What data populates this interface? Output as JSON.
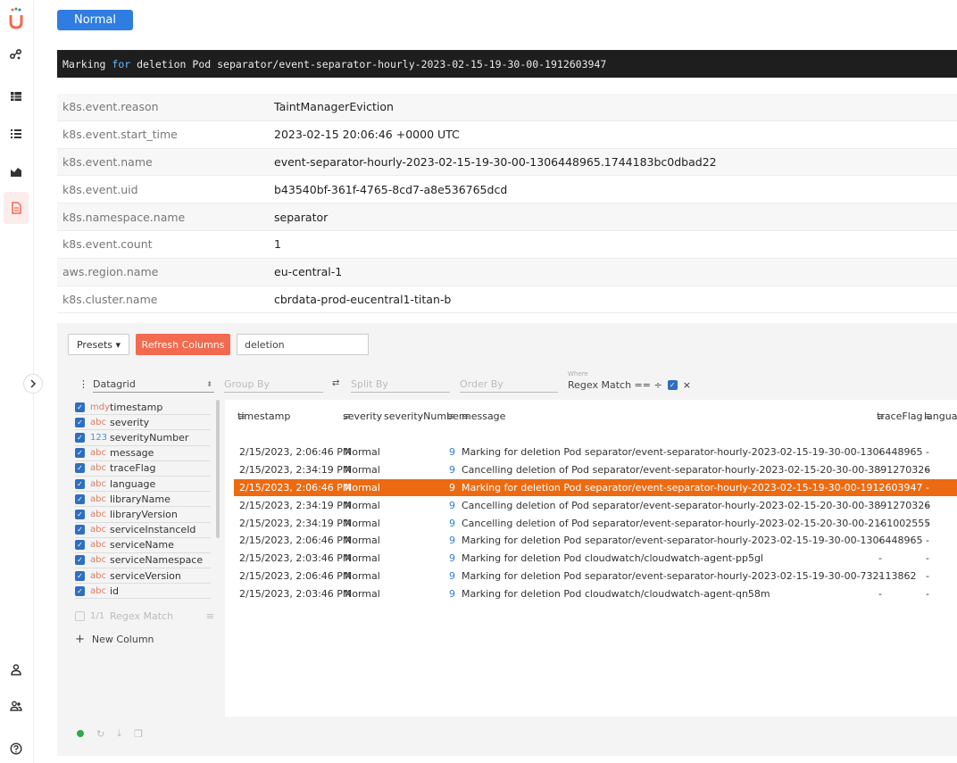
{
  "sidebar": {
    "logo_letter": "U",
    "items": [
      "share-icon",
      "table-icon",
      "list-icon",
      "dashboard-icon",
      "document-icon"
    ],
    "bottom_items": [
      "user-icon",
      "team-icon",
      "help-icon"
    ]
  },
  "log": {
    "level": "Normal",
    "message_prefix": "Marking ",
    "message_kw": "for",
    "message_rest": " deletion Pod separator/event-separator-hourly-2023-02-15-19-30-00-1912603947"
  },
  "attributes": [
    {
      "key": "k8s.event.reason",
      "value": "TaintManagerEviction"
    },
    {
      "key": "k8s.event.start_time",
      "value": "2023-02-15 20:06:46 +0000 UTC"
    },
    {
      "key": "k8s.event.name",
      "value": "event-separator-hourly-2023-02-15-19-30-00-1306448965.1744183bc0dbad22"
    },
    {
      "key": "k8s.event.uid",
      "value": "b43540bf-361f-4765-8cd7-a8e536765dcd"
    },
    {
      "key": "k8s.namespace.name",
      "value": "separator"
    },
    {
      "key": "k8s.event.count",
      "value": "1"
    },
    {
      "key": "aws.region.name",
      "value": "eu-central-1"
    },
    {
      "key": "k8s.cluster.name",
      "value": "cbrdata-prod-eucentral1-titan-b"
    }
  ],
  "toolbar": {
    "presets_label": "Presets ▾",
    "refresh_label": "Refresh Columns",
    "search_value": "deletion"
  },
  "controls": {
    "view": "Datagrid",
    "group_by_placeholder": "Group By",
    "split_by_placeholder": "Split By",
    "order_by_placeholder": "Order By",
    "where_label": "Where",
    "where_value": "Regex Match == ÷"
  },
  "columns": [
    {
      "type": "mdy",
      "name": "timestamp"
    },
    {
      "type": "abc",
      "name": "severity"
    },
    {
      "type": "123",
      "name": "severityNumber"
    },
    {
      "type": "abc",
      "name": "message"
    },
    {
      "type": "abc",
      "name": "traceFlag"
    },
    {
      "type": "abc",
      "name": "language"
    },
    {
      "type": "abc",
      "name": "libraryName"
    },
    {
      "type": "abc",
      "name": "libraryVersion"
    },
    {
      "type": "abc",
      "name": "serviceInstanceId"
    },
    {
      "type": "abc",
      "name": "serviceName"
    },
    {
      "type": "abc",
      "name": "serviceNamespace"
    },
    {
      "type": "abc",
      "name": "serviceVersion"
    },
    {
      "type": "abc",
      "name": "id"
    }
  ],
  "regex_column": {
    "type": "1/1",
    "name": "Regex Match"
  },
  "new_column_label": "New Column",
  "grid": {
    "headers": [
      "timestamp",
      "severity",
      "severityNumber",
      "message",
      "traceFlag",
      "languag"
    ],
    "rows": [
      {
        "ts": "2/15/2023, 2:06:46 PM",
        "sev": "Normal",
        "num": "9",
        "msg": "Marking for deletion Pod separator/event-separator-hourly-2023-02-15-19-30-00-1306448965",
        "tf": "-",
        "lang": "-"
      },
      {
        "ts": "2/15/2023, 2:34:19 PM",
        "sev": "Normal",
        "num": "9",
        "msg": "Cancelling deletion of Pod separator/event-separator-hourly-2023-02-15-20-30-00-3891270326",
        "tf": "-",
        "lang": "-"
      },
      {
        "ts": "2/15/2023, 2:06:46 PM",
        "sev": "Normal",
        "num": "9",
        "msg": "Marking for deletion Pod separator/event-separator-hourly-2023-02-15-19-30-00-1912603947",
        "tf": "-",
        "lang": "-"
      },
      {
        "ts": "2/15/2023, 2:34:19 PM",
        "sev": "Normal",
        "num": "9",
        "msg": "Cancelling deletion of Pod separator/event-separator-hourly-2023-02-15-20-30-00-3891270326",
        "tf": "-",
        "lang": "-"
      },
      {
        "ts": "2/15/2023, 2:34:19 PM",
        "sev": "Normal",
        "num": "9",
        "msg": "Cancelling deletion of Pod separator/event-separator-hourly-2023-02-15-20-30-00-2161002555",
        "tf": "-",
        "lang": "-"
      },
      {
        "ts": "2/15/2023, 2:06:46 PM",
        "sev": "Normal",
        "num": "9",
        "msg": "Marking for deletion Pod separator/event-separator-hourly-2023-02-15-19-30-00-1306448965",
        "tf": "-",
        "lang": "-"
      },
      {
        "ts": "2/15/2023, 2:03:46 PM",
        "sev": "Normal",
        "num": "9",
        "msg": "Marking for deletion Pod cloudwatch/cloudwatch-agent-pp5gl",
        "tf": "-",
        "lang": "-"
      },
      {
        "ts": "2/15/2023, 2:06:46 PM",
        "sev": "Normal",
        "num": "9",
        "msg": "Marking for deletion Pod separator/event-separator-hourly-2023-02-15-19-30-00-732113862",
        "tf": "-",
        "lang": "-"
      },
      {
        "ts": "2/15/2023, 2:03:46 PM",
        "sev": "Normal",
        "num": "9",
        "msg": "Marking for deletion Pod cloudwatch/cloudwatch-agent-qn58m",
        "tf": "-",
        "lang": "-"
      }
    ],
    "selected_row": 2
  },
  "colors": {
    "accent": "#2f7de1",
    "selected_row": "#ec6b12",
    "refresh": "#f26a4f",
    "status": "#2ea84a"
  }
}
